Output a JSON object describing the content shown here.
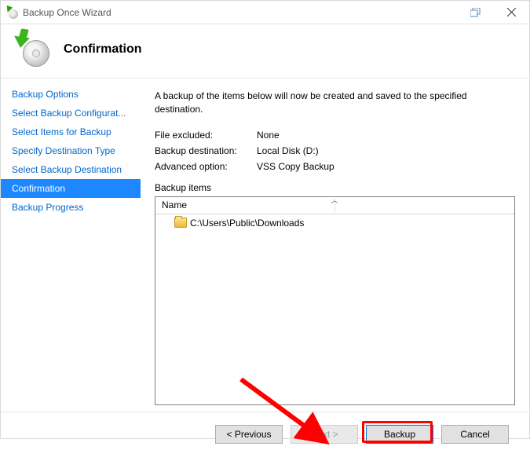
{
  "window": {
    "title": "Backup Once Wizard"
  },
  "header": {
    "title": "Confirmation"
  },
  "sidebar": {
    "items": [
      {
        "label": "Backup Options"
      },
      {
        "label": "Select Backup Configurat..."
      },
      {
        "label": "Select Items for Backup"
      },
      {
        "label": "Specify Destination Type"
      },
      {
        "label": "Select Backup Destination"
      },
      {
        "label": "Confirmation"
      },
      {
        "label": "Backup Progress"
      }
    ],
    "selected_index": 5
  },
  "main": {
    "intro": "A backup of the items below will now be created and saved to the specified destination.",
    "rows": {
      "file_excluded_label": "File excluded:",
      "file_excluded_value": "None",
      "backup_dest_label": "Backup destination:",
      "backup_dest_value": "Local Disk (D:)",
      "advanced_opt_label": "Advanced option:",
      "advanced_opt_value": "VSS Copy Backup"
    },
    "items": {
      "section_label": "Backup items",
      "columns": {
        "name": "Name"
      },
      "rows": [
        {
          "path": "C:\\Users\\Public\\Downloads"
        }
      ]
    }
  },
  "footer": {
    "previous": "< Previous",
    "next": "Next >",
    "backup": "Backup",
    "cancel": "Cancel"
  }
}
